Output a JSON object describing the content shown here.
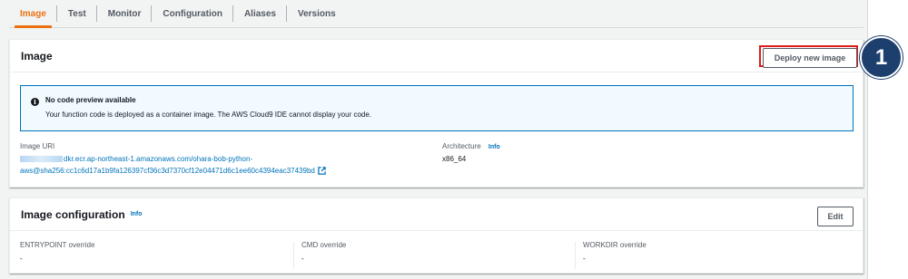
{
  "tabs": [
    "Image",
    "Test",
    "Monitor",
    "Configuration",
    "Aliases",
    "Versions"
  ],
  "active_tab": "Image",
  "image_panel": {
    "title": "Image",
    "deploy_button": "Deploy new image",
    "callout_number": "1",
    "alert": {
      "title": "No code preview available",
      "text": "Your function code is deployed as a container image. The AWS Cloud9 IDE cannot display your code."
    },
    "image_uri_label": "Image URI",
    "image_uri_line1": "dkr.ecr.ap-northeast-1.amazonaws.com/ohara-bob-python-",
    "image_uri_line2": "aws@sha256:cc1c6d17a1b9fa126397cf36c3d7370cf12e04471d6c1ee60c4394eac37439bd",
    "architecture_label": "Architecture",
    "architecture_info": "Info",
    "architecture_value": "x86_64"
  },
  "config_panel": {
    "title": "Image configuration",
    "info": "Info",
    "edit_button": "Edit",
    "entrypoint_label": "ENTRYPOINT override",
    "entrypoint_value": "-",
    "cmd_label": "CMD override",
    "cmd_value": "-",
    "workdir_label": "WORKDIR override",
    "workdir_value": "-"
  },
  "colors": {
    "accent": "#ec7211",
    "link": "#0073bb",
    "highlight": "#e01b1b",
    "callout": "#1d3f6e"
  }
}
